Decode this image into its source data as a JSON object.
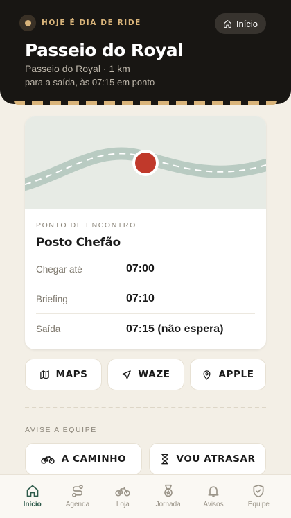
{
  "header": {
    "badge": "HOJE É DIA DE RIDE",
    "home_button": "Início",
    "title": "Passeio do Royal",
    "subtitle": "Passeio do Royal · 1 km",
    "departure": "para a saída, às 07:15 em ponto"
  },
  "meeting": {
    "label": "PONTO DE ENCONTRO",
    "name": "Posto Chefão",
    "rows": [
      {
        "label": "Chegar até",
        "value": "07:00"
      },
      {
        "label": "Briefing",
        "value": "07:10"
      },
      {
        "label": "Saída",
        "value": "07:15 (não espera)"
      }
    ]
  },
  "navigation": [
    {
      "label": "MAPS",
      "icon": "map-icon"
    },
    {
      "label": "WAZE",
      "icon": "navigation-arrow-icon"
    },
    {
      "label": "APPLE",
      "icon": "map-pin-icon"
    }
  ],
  "team": {
    "label": "AVISE A EQUIPE",
    "buttons": [
      {
        "label": "A CAMINHO",
        "icon": "bicycle-icon"
      },
      {
        "label": "VOU ATRASAR",
        "icon": "hourglass-icon"
      }
    ]
  },
  "tabs": [
    {
      "label": "Início",
      "icon": "home-icon",
      "active": true
    },
    {
      "label": "Agenda",
      "icon": "route-icon",
      "active": false
    },
    {
      "label": "Loja",
      "icon": "bicycle-icon",
      "active": false
    },
    {
      "label": "Jornada",
      "icon": "medal-icon",
      "active": false
    },
    {
      "label": "Avisos",
      "icon": "bell-icon",
      "active": false
    },
    {
      "label": "Equipe",
      "icon": "shield-icon",
      "active": false
    }
  ],
  "colors": {
    "header_bg": "#181613",
    "accent_gold": "#d9b47a",
    "pin_red": "#c0392b",
    "road": "#b9cbc2",
    "active_tab": "#2d5a4a",
    "background": "#f3efe6"
  }
}
